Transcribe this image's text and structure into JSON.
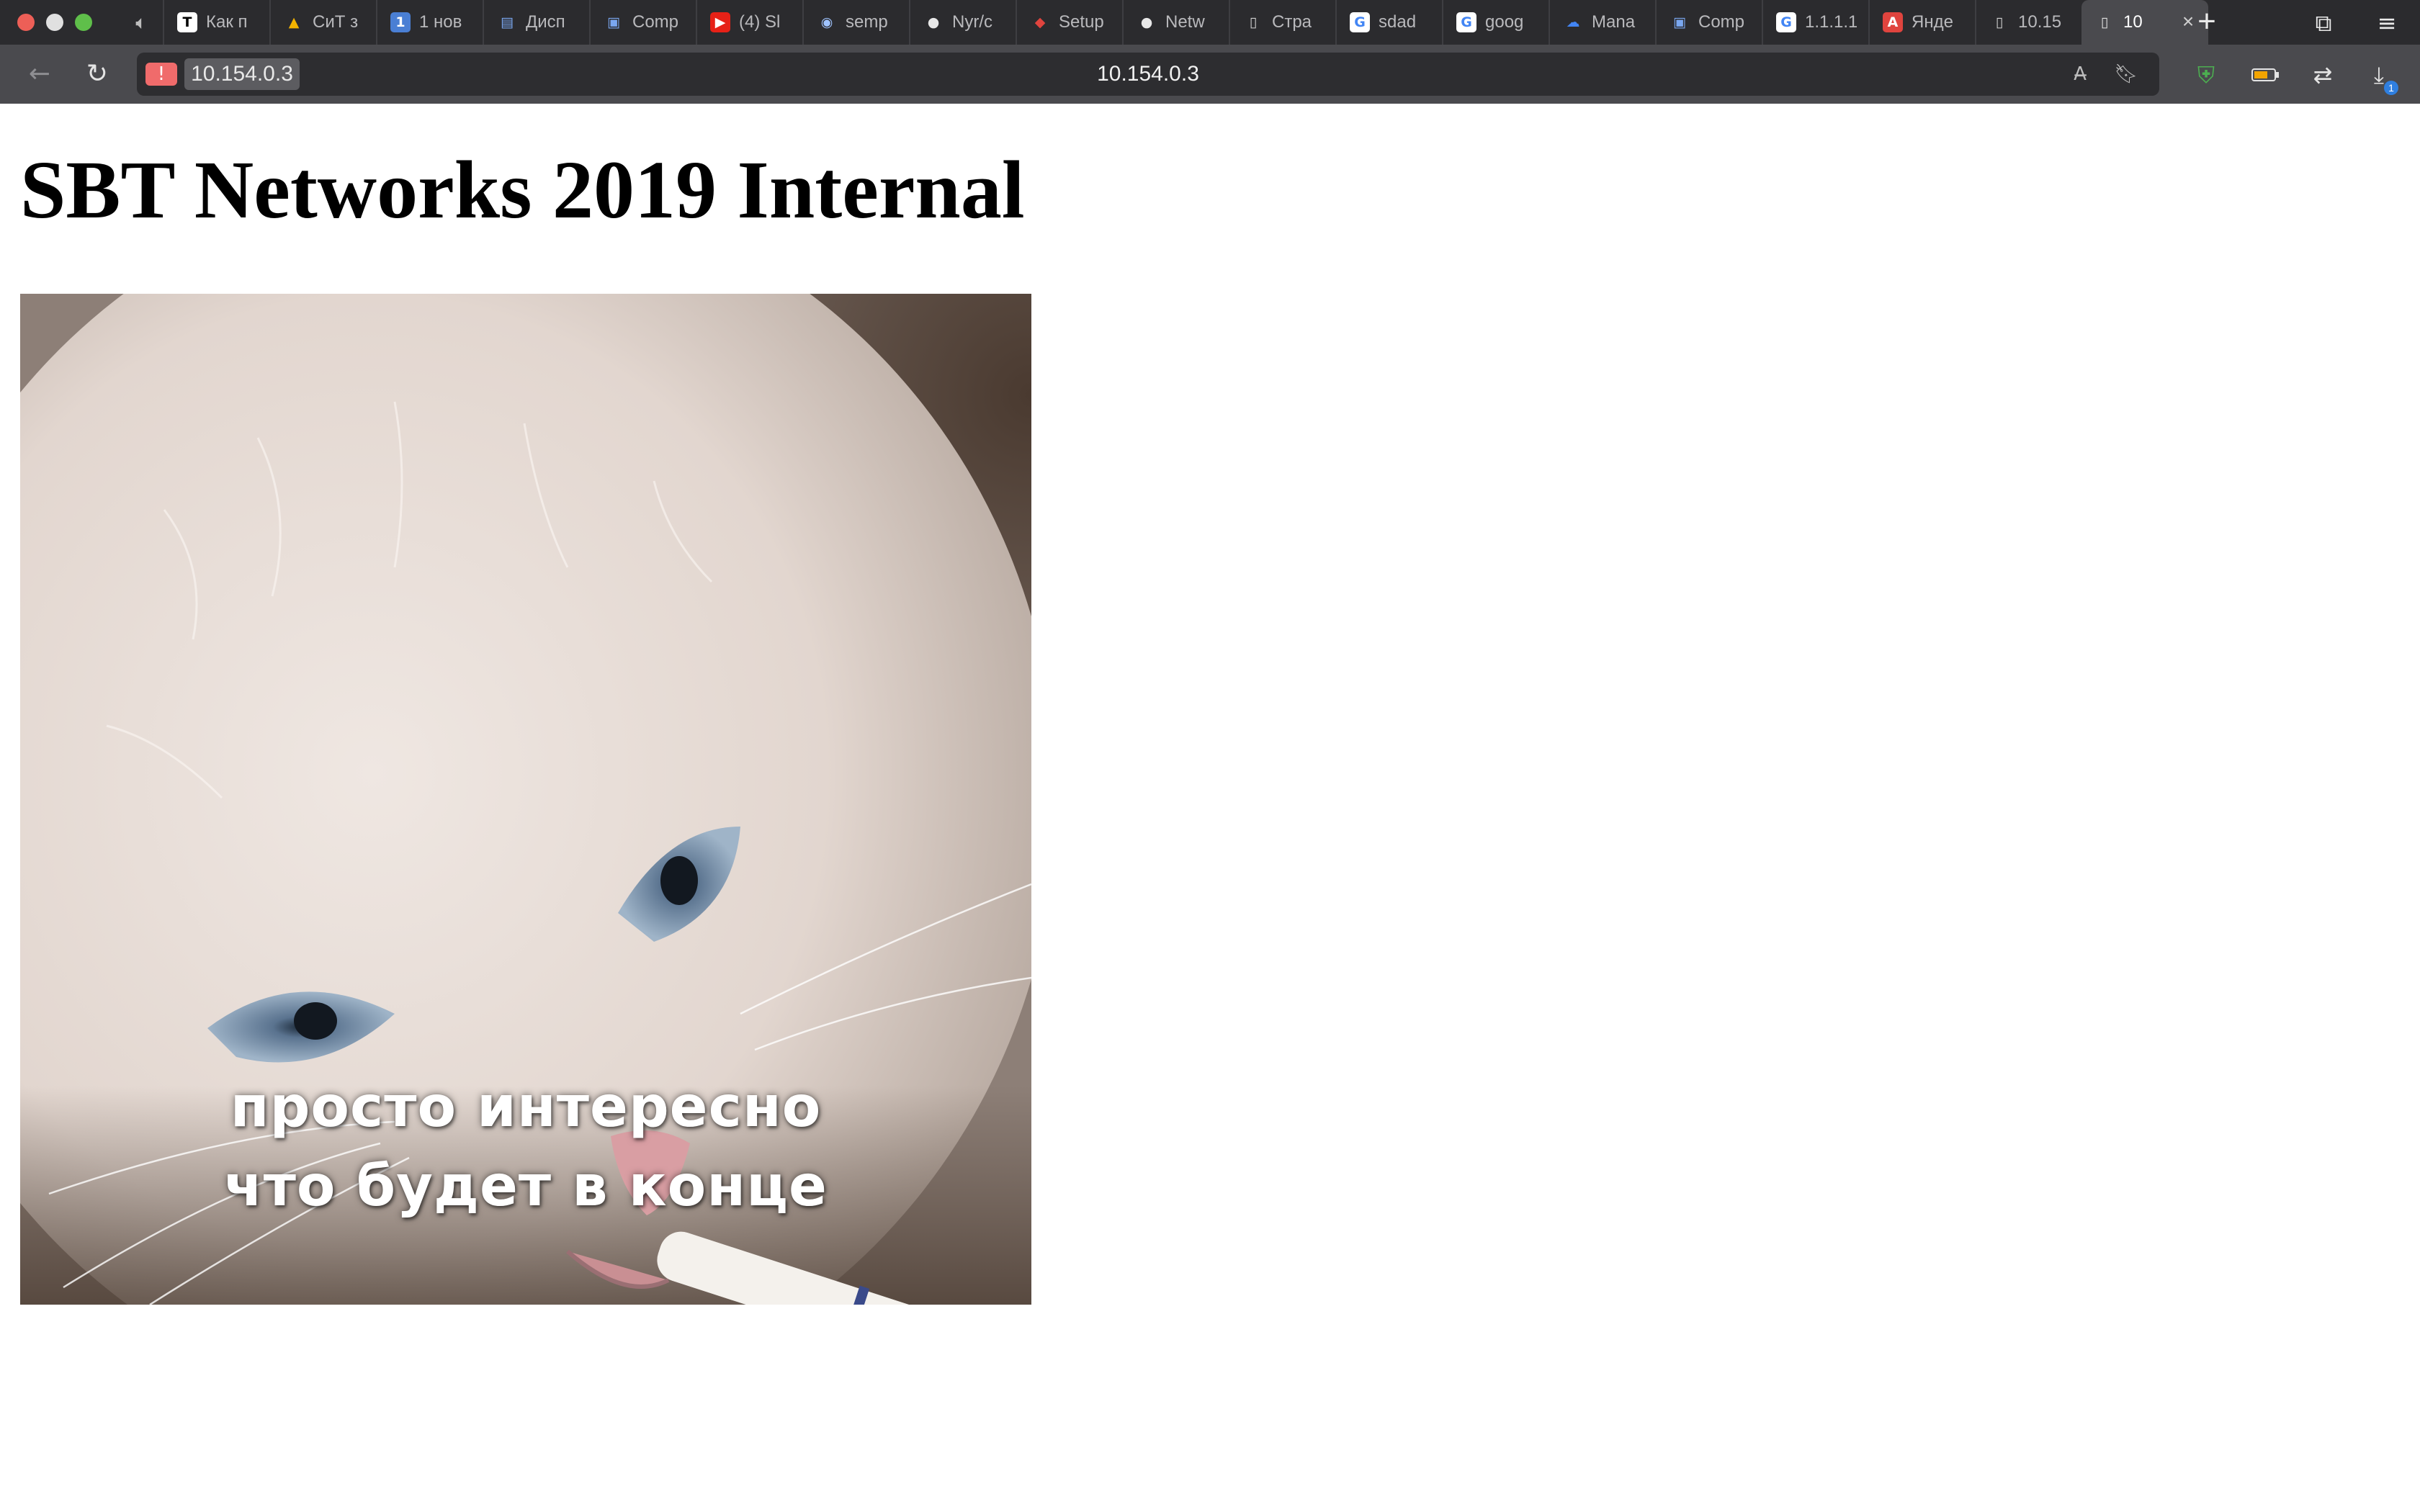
{
  "browser": {
    "tabs": [
      {
        "label": "Как п",
        "icon": "t-logo-icon",
        "icon_char": "T",
        "icon_bg": "#ffffff",
        "icon_fg": "#000000"
      },
      {
        "label": "СиТ з",
        "icon": "google-drive-icon",
        "icon_char": "▲",
        "icon_bg": "transparent",
        "icon_fg": "#f4b400"
      },
      {
        "label": "1 нов",
        "icon": "number-one-icon",
        "icon_char": "1",
        "icon_bg": "#4a7fd4",
        "icon_fg": "#ffffff"
      },
      {
        "label": "Дисп",
        "icon": "monitor-chart-icon",
        "icon_char": "▤",
        "icon_bg": "transparent",
        "icon_fg": "#7aa7f0"
      },
      {
        "label": "Comp",
        "icon": "chip-icon",
        "icon_char": "▣",
        "icon_bg": "transparent",
        "icon_fg": "#7aa7f0"
      },
      {
        "label": "(4) Sl",
        "icon": "youtube-icon",
        "icon_char": "▶",
        "icon_bg": "#e62117",
        "icon_fg": "#ffffff"
      },
      {
        "label": "semp",
        "icon": "globe-icon",
        "icon_char": "◉",
        "icon_bg": "transparent",
        "icon_fg": "#9fc3ff"
      },
      {
        "label": "Nyr/c",
        "icon": "github-icon",
        "icon_char": "●",
        "icon_bg": "transparent",
        "icon_fg": "#e8e8e8"
      },
      {
        "label": "Setup",
        "icon": "shield-logo-icon",
        "icon_char": "◆",
        "icon_bg": "transparent",
        "icon_fg": "#e0443e"
      },
      {
        "label": "Netw",
        "icon": "github-icon",
        "icon_char": "●",
        "icon_bg": "transparent",
        "icon_fg": "#e8e8e8"
      },
      {
        "label": "Стра",
        "icon": "document-icon",
        "icon_char": "▯",
        "icon_bg": "transparent",
        "icon_fg": "#d0d0d0"
      },
      {
        "label": "sdad",
        "icon": "google-icon",
        "icon_char": "G",
        "icon_bg": "#ffffff",
        "icon_fg": "#4285f4"
      },
      {
        "label": "goog",
        "icon": "google-icon",
        "icon_char": "G",
        "icon_bg": "#ffffff",
        "icon_fg": "#4285f4"
      },
      {
        "label": "Mana",
        "icon": "google-cloud-icon",
        "icon_char": "☁",
        "icon_bg": "transparent",
        "icon_fg": "#4285f4"
      },
      {
        "label": "Comp",
        "icon": "chip-icon",
        "icon_char": "▣",
        "icon_bg": "transparent",
        "icon_fg": "#7aa7f0"
      },
      {
        "label": "1.1.1.1",
        "icon": "google-icon",
        "icon_char": "G",
        "icon_bg": "#ffffff",
        "icon_fg": "#4285f4"
      },
      {
        "label": "Янде",
        "icon": "yandex-translate-icon",
        "icon_char": "A",
        "icon_bg": "#e0443e",
        "icon_fg": "#ffffff"
      },
      {
        "label": "10.15",
        "icon": "document-icon",
        "icon_char": "▯",
        "icon_bg": "transparent",
        "icon_fg": "#d0d0d0"
      }
    ],
    "active_tab": {
      "label": "10",
      "icon": "document-icon",
      "icon_char": "▯",
      "close": "×"
    },
    "new_tab": "+",
    "url_chip_host": "10.154.0.3",
    "url": "10.154.0.3",
    "warning_icon": "!"
  },
  "page": {
    "heading": "SBT Networks 2019 Internal",
    "image_caption_line1": "просто интересно",
    "image_caption_line2": "что будет в конце"
  },
  "downloads_badge": "1"
}
